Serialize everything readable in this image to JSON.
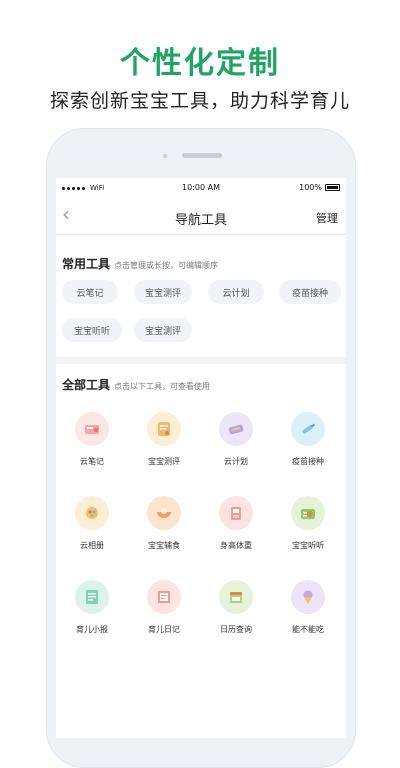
{
  "promo": {
    "headline": "个性化定制",
    "subline": "探索创新宝宝工具，助力科学育儿"
  },
  "statusbar": {
    "wifi": "WiFi",
    "time": "10:00 AM",
    "battery_pct": "100%"
  },
  "navbar": {
    "back_icon": "‹",
    "title": "导航工具",
    "manage": "管理"
  },
  "common_tools": {
    "title": "常用工具",
    "hint": "点击管理或长按，可编辑顺序",
    "items": [
      "云笔记",
      "宝宝测评",
      "云计划",
      "疫苗接种",
      "宝宝听听",
      "宝宝测评"
    ]
  },
  "all_tools": {
    "title": "全部工具",
    "hint": "点击以下工具，可查看使用",
    "items": [
      {
        "label": "云笔记",
        "icon": "notebook-icon",
        "color": "#f4a5a0"
      },
      {
        "label": "宝宝测评",
        "icon": "evaluation-icon",
        "color": "#f4b86a"
      },
      {
        "label": "云计划",
        "icon": "plan-icon",
        "color": "#b7a3e0"
      },
      {
        "label": "疫苗接种",
        "icon": "vaccine-icon",
        "color": "#7cc6e6"
      },
      {
        "label": "云相册",
        "icon": "album-icon",
        "color": "#f4c06a"
      },
      {
        "label": "宝宝辅食",
        "icon": "food-bowl-icon",
        "color": "#f2a15a"
      },
      {
        "label": "身高体重",
        "icon": "height-weight-icon",
        "color": "#f19b94"
      },
      {
        "label": "宝宝听听",
        "icon": "radio-icon",
        "color": "#8fc96a"
      },
      {
        "label": "育儿小报",
        "icon": "newspaper-icon",
        "color": "#7fd1b7"
      },
      {
        "label": "育儿日记",
        "icon": "diary-icon",
        "color": "#f29a92"
      },
      {
        "label": "日历查询",
        "icon": "calendar-icon",
        "color": "#a8d67a"
      },
      {
        "label": "能不能吃",
        "icon": "icecream-icon",
        "color": "#c3a6e8"
      }
    ]
  }
}
